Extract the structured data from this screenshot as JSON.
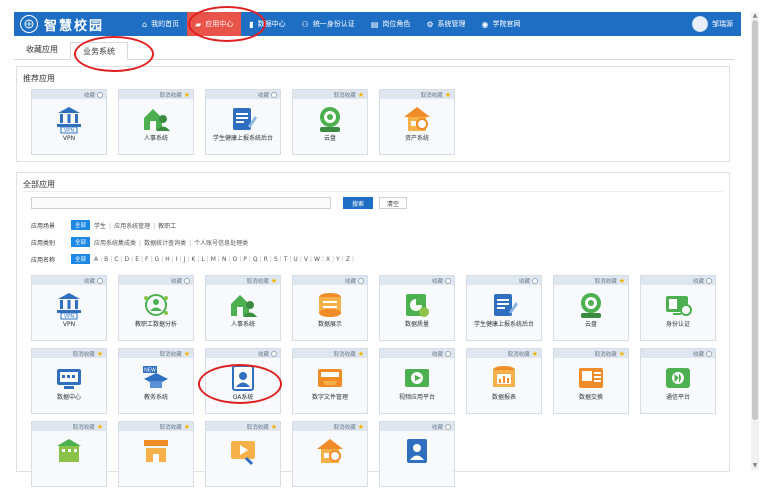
{
  "header": {
    "logo_text": "智慧校园",
    "nav": [
      {
        "icon": "home-icon",
        "glyph": "⌂",
        "label": "我的首页"
      },
      {
        "icon": "cart-icon",
        "glyph": "▰",
        "label": "应用中心"
      },
      {
        "icon": "chart-icon",
        "glyph": "▮",
        "label": "数据中心"
      },
      {
        "icon": "users-icon",
        "glyph": "⚇",
        "label": "统一身份认证"
      },
      {
        "icon": "id-card-icon",
        "glyph": "▤",
        "label": "岗位角色"
      },
      {
        "icon": "gear-icon",
        "glyph": "⚙",
        "label": "系统管理"
      },
      {
        "icon": "globe-icon",
        "glyph": "◉",
        "label": "学院官网"
      }
    ],
    "user_name": "邹瑞源"
  },
  "tabs": [
    "收藏应用",
    "业务系统"
  ],
  "recommended": {
    "title": "推荐应用",
    "apps": [
      {
        "name": "VPN",
        "fav": "收藏",
        "starred": false,
        "icon": "vpn-icon"
      },
      {
        "name": "人事系统",
        "fav": "取消收藏",
        "starred": true,
        "icon": "hr-icon"
      },
      {
        "name": "学生健康上报系统后台",
        "fav": "收藏",
        "starred": false,
        "icon": "health-report-icon"
      },
      {
        "name": "云盘",
        "fav": "取消收藏",
        "starred": true,
        "icon": "cloud-disk-icon"
      },
      {
        "name": "资产系统",
        "fav": "取消收藏",
        "starred": true,
        "icon": "asset-icon"
      }
    ]
  },
  "all_apps": {
    "title": "全部应用",
    "search": {
      "placeholder": "",
      "search_label": "搜索",
      "clear_label": "清空"
    },
    "filters": {
      "group": {
        "label": "应用场景",
        "active": "全部",
        "options": [
          "学生",
          "应用系统管理",
          "教职工"
        ]
      },
      "type": {
        "label": "应用类别",
        "active": "全部",
        "options": [
          "应用系统集成类",
          "数据统计查询类",
          "个人账号信息处理类"
        ]
      },
      "name": {
        "label": "应用名称",
        "active": "全部",
        "letters": [
          "A",
          "B",
          "C",
          "D",
          "E",
          "F",
          "G",
          "H",
          "I",
          "J",
          "K",
          "L",
          "M",
          "N",
          "O",
          "P",
          "Q",
          "R",
          "S",
          "T",
          "U",
          "V",
          "W",
          "X",
          "Y",
          "Z"
        ]
      }
    },
    "apps": [
      {
        "name": "VPN",
        "fav": "收藏",
        "starred": false,
        "icon": "vpn-icon"
      },
      {
        "name": "教职工数据分析",
        "fav": "收藏",
        "starred": false,
        "icon": "staff-analysis-icon"
      },
      {
        "name": "人事系统",
        "fav": "取消收藏",
        "starred": true,
        "icon": "hr-icon"
      },
      {
        "name": "数据展示",
        "fav": "收藏",
        "starred": false,
        "icon": "data-display-icon"
      },
      {
        "name": "数据质量",
        "fav": "收藏",
        "starred": false,
        "icon": "data-quality-icon"
      },
      {
        "name": "学生健康上报系统后台",
        "fav": "收藏",
        "starred": false,
        "icon": "health-report-icon"
      },
      {
        "name": "云盘",
        "fav": "取消收藏",
        "starred": true,
        "icon": "cloud-disk-icon"
      },
      {
        "name": "身份认证",
        "fav": "收藏",
        "starred": false,
        "icon": "identity-icon"
      },
      {
        "name": "数据中心",
        "fav": "取消收藏",
        "starred": true,
        "icon": "data-center-icon"
      },
      {
        "name": "教务系统",
        "fav": "取消收藏",
        "starred": true,
        "icon": "academic-icon"
      },
      {
        "name": "OA系统",
        "fav": "收藏",
        "starred": false,
        "icon": "oa-icon"
      },
      {
        "name": "数字文件管理",
        "fav": "取消收藏",
        "starred": true,
        "icon": "file-manage-icon"
      },
      {
        "name": "视频应用平台",
        "fav": "收藏",
        "starred": false,
        "icon": "video-icon"
      },
      {
        "name": "数据报表",
        "fav": "取消收藏",
        "starred": true,
        "icon": "data-report-icon"
      },
      {
        "name": "数据交换",
        "fav": "取消收藏",
        "starred": true,
        "icon": "data-exchange-icon"
      },
      {
        "name": "通信平台",
        "fav": "收藏",
        "starred": false,
        "icon": "communication-icon"
      },
      {
        "name": "",
        "fav": "取消收藏",
        "starred": true,
        "icon": "building-icon"
      },
      {
        "name": "",
        "fav": "取消收藏",
        "starred": true,
        "icon": "school-icon"
      },
      {
        "name": "",
        "fav": "取消收藏",
        "starred": true,
        "icon": "media-icon"
      },
      {
        "name": "",
        "fav": "取消收藏",
        "starred": true,
        "icon": "asset-icon"
      },
      {
        "name": "",
        "fav": "收藏",
        "starred": false,
        "icon": "user-card-icon"
      }
    ]
  },
  "colors": {
    "header": "#1e6fc4",
    "active_nav": "#e8534a",
    "chip": "#1e88e5",
    "annotation": "#e02020"
  }
}
